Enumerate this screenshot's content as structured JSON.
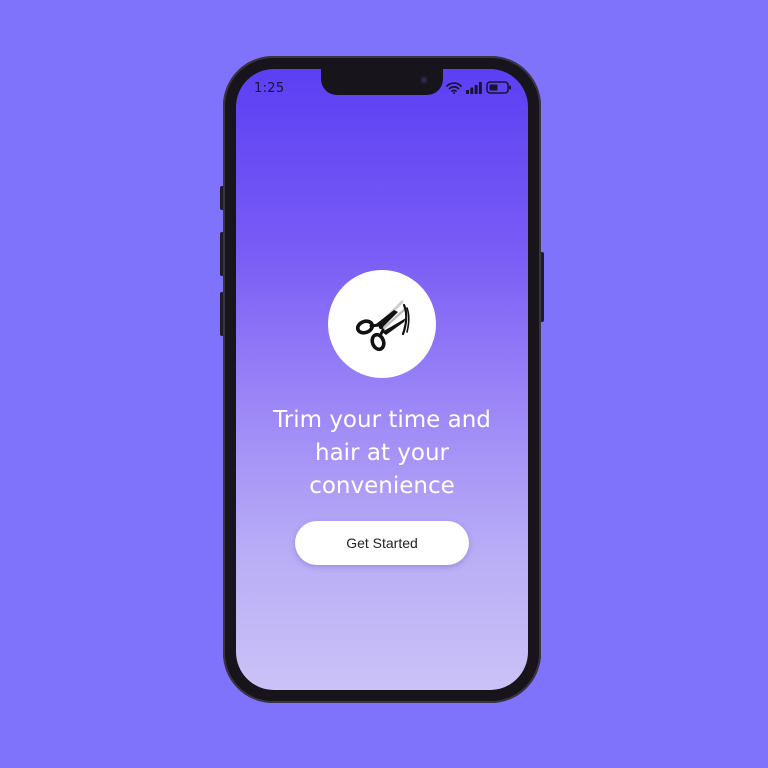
{
  "status_bar": {
    "time": "1:25",
    "icons": [
      "wifi-icon",
      "signal-icon",
      "battery-icon"
    ]
  },
  "logo": {
    "icon": "scissors-icon"
  },
  "headline": {
    "lines": [
      "Trim your time and",
      "hair at your",
      "convenience"
    ]
  },
  "cta": {
    "label": "Get Started"
  },
  "colors": {
    "background": "#8073fb",
    "gradient_top": "#5b3ff4",
    "gradient_bottom": "#cbc2f7",
    "button": "#ffffff"
  }
}
